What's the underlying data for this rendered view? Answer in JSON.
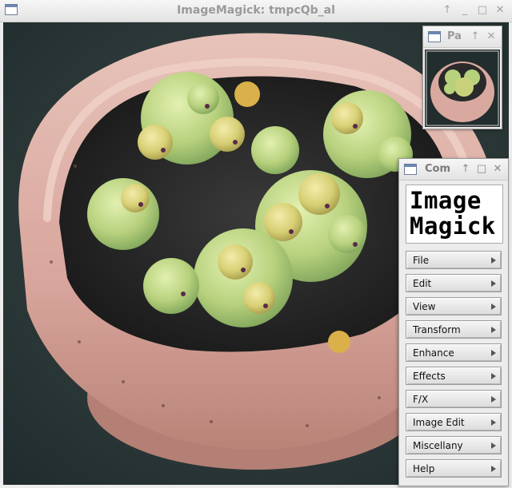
{
  "main_window": {
    "title": "ImageMagick: tmpcQb_al",
    "controls": [
      "↑",
      "_",
      "□",
      "✕"
    ]
  },
  "pan_window": {
    "title": "Pa",
    "controls": [
      "↑",
      "✕"
    ]
  },
  "commands_window": {
    "title": "Com",
    "controls": [
      "↑",
      "□",
      "✕"
    ],
    "logo_line1": "Image",
    "logo_line2": "Magick",
    "menu": [
      {
        "label": "File"
      },
      {
        "label": "Edit"
      },
      {
        "label": "View"
      },
      {
        "label": "Transform"
      },
      {
        "label": "Enhance"
      },
      {
        "label": "Effects"
      },
      {
        "label": "F/X"
      },
      {
        "label": "Image Edit"
      },
      {
        "label": "Miscellany"
      },
      {
        "label": "Help"
      }
    ]
  },
  "colors": {
    "pot": "#d9a9a0",
    "soil": "#2b2b2b",
    "leaf": "#b7d17d",
    "background": "#2c3a3a"
  }
}
